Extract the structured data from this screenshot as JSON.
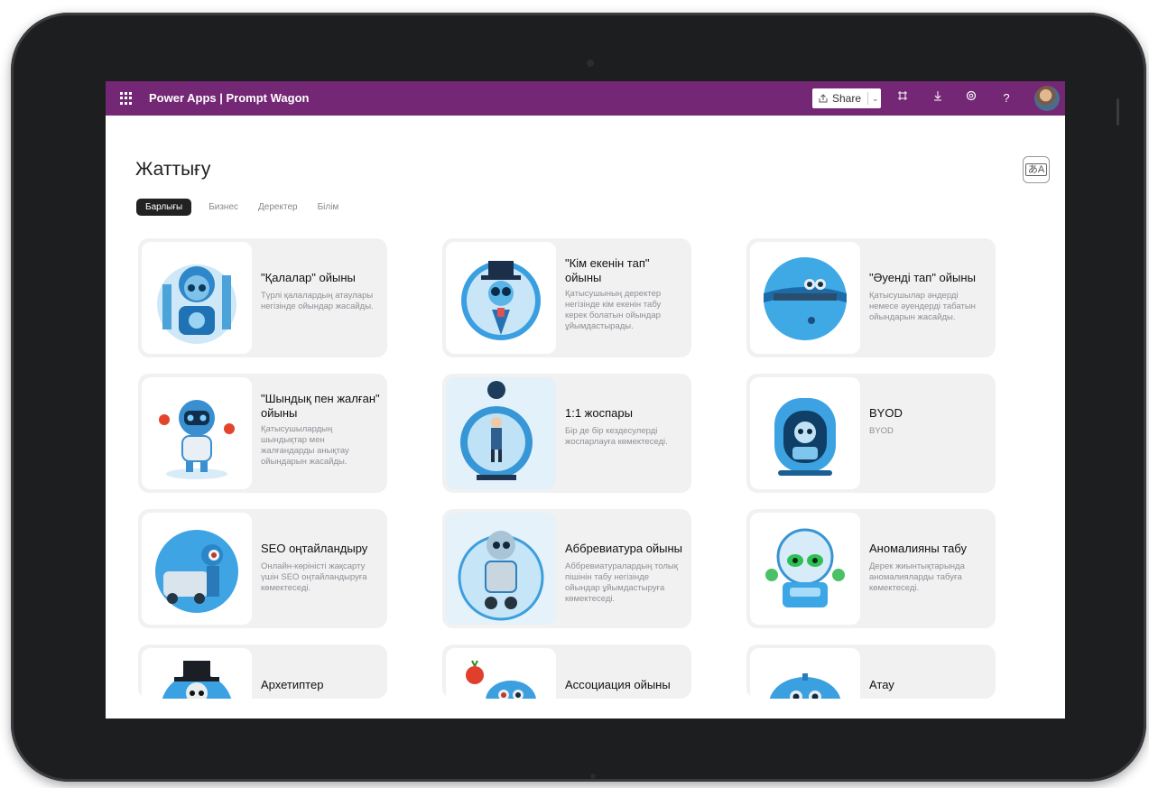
{
  "topbar": {
    "app_title": "Power Apps | Prompt Wagon",
    "share_label": "Share",
    "icons": [
      "waffle-icon",
      "share-icon",
      "fit-to-window-icon",
      "download-icon",
      "settings-icon",
      "help-icon",
      "avatar"
    ],
    "accent_color": "#742774"
  },
  "page": {
    "title": "Жаттығу",
    "tabs": [
      {
        "label": "Барлығы",
        "active": true
      },
      {
        "label": "Бизнес",
        "active": false
      },
      {
        "label": "Деректер",
        "active": false
      },
      {
        "label": "Білім",
        "active": false
      }
    ]
  },
  "cards": [
    {
      "title": "\"Қалалар\" ойыны",
      "desc": "Түрлі қалалардың атаулары негізінде ойындар жасайды."
    },
    {
      "title": "\"Кім екенін тап\" ойыны",
      "desc": "Қатысушының деректер негізінде кім екенін табу керек болатын ойындар ұйымдастырады."
    },
    {
      "title": "\"Әуенді тап\" ойыны",
      "desc": "Қатысушылар әндерді немесе әуендерді табатын ойындарын жасайды."
    },
    {
      "title": "\"Шындық пен жалған\" ойыны",
      "desc": "Қатысушылардың шындықтар мен жалғандарды анықтау ойындарын жасайды."
    },
    {
      "title": "1:1 жоспары",
      "desc": "Бір де бір кездесулерді жоспарлауға көмектеседі."
    },
    {
      "title": "BYOD",
      "desc": "BYOD"
    },
    {
      "title": "SEO оңтайландыру",
      "desc": "Онлайн-көріністі жақсарту үшін SEO оңтайландыруға көмектеседі."
    },
    {
      "title": "Аббревиатура ойыны",
      "desc": "Аббревиатуралардың толық пішінін табу негізінде ойындар ұйымдастыруға көмектеседі."
    },
    {
      "title": "Аномалияны табу",
      "desc": "Дерек жиынтықтарында аномалияларды табуға көмектеседі."
    },
    {
      "title": "Архетиптер",
      "desc": ""
    },
    {
      "title": "Ассоциация ойыны",
      "desc": ""
    },
    {
      "title": "Атау",
      "desc": ""
    }
  ]
}
